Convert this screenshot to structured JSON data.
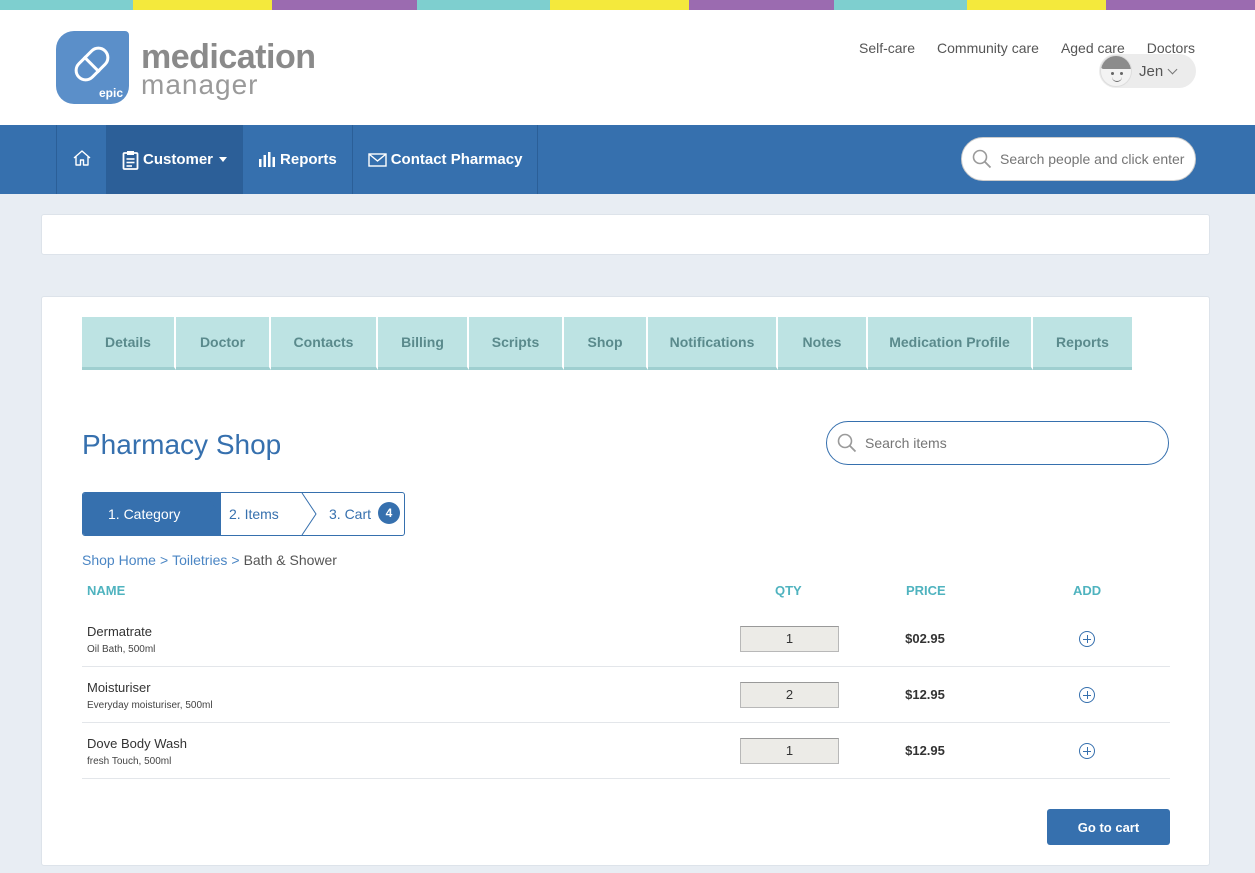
{
  "colors": {
    "stripe": [
      "#7ecfcf",
      "#f4e93c",
      "#9b6bb0"
    ],
    "nav": "#3670ae",
    "tab": "#bde3e3",
    "header_cols": "#4fb3bf"
  },
  "logo": {
    "line1": "medication",
    "line2": "manager",
    "badge": "epic",
    "icon": "pill-icon"
  },
  "top_links": [
    "Self-care",
    "Community care",
    "Aged care",
    "Doctors"
  ],
  "user": {
    "name": "Jen"
  },
  "nav": {
    "home_icon": "home-icon",
    "items": [
      {
        "label": "Customer",
        "icon": "clipboard-icon"
      },
      {
        "label": "Reports",
        "icon": "bar-chart-icon"
      },
      {
        "label": "Contact Pharmacy",
        "icon": "envelope-icon"
      }
    ],
    "search_placeholder": "Search people and click enter"
  },
  "tabs": [
    "Details",
    "Doctor",
    "Contacts",
    "Billing",
    "Scripts",
    "Shop",
    "Notifications",
    "Notes",
    "Medication Profile",
    "Reports"
  ],
  "shop": {
    "title": "Pharmacy Shop",
    "search_placeholder": "Search items",
    "steps": [
      "1. Category",
      "2. Items",
      "3. Cart"
    ],
    "cart_count": "4",
    "breadcrumb": [
      "Shop Home",
      "Toiletries",
      "Bath & Shower"
    ],
    "columns": {
      "name": "NAME",
      "qty": "QTY",
      "price": "PRICE",
      "add": "ADD"
    },
    "items": [
      {
        "name": "Dermatrate",
        "desc": "Oil Bath, 500ml",
        "qty": "1",
        "price": "$02.95"
      },
      {
        "name": "Moisturiser",
        "desc": "Everyday moisturiser, 500ml",
        "qty": "2",
        "price": "$12.95"
      },
      {
        "name": "Dove Body Wash",
        "desc": "fresh Touch, 500ml",
        "qty": "1",
        "price": "$12.95"
      }
    ],
    "go_cart": "Go to cart"
  }
}
